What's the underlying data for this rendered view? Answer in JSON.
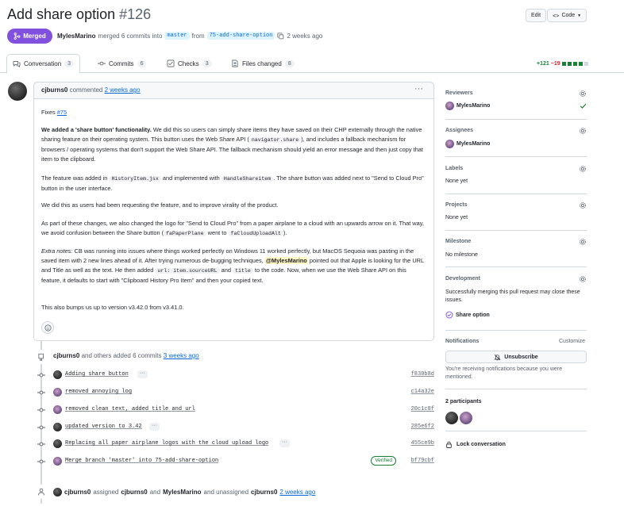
{
  "header": {
    "title": "Add share option",
    "number": "#126",
    "edit_label": "Edit",
    "code_label": "Code",
    "status_label": "Merged",
    "author": "MylesMarino",
    "merge_text": "merged 6 commits into",
    "base_branch": "master",
    "from_text": "from",
    "head_branch": "75-add-share-option",
    "time": "2 weeks ago"
  },
  "tabs": [
    {
      "label": "Conversation",
      "count": "3"
    },
    {
      "label": "Commits",
      "count": "6"
    },
    {
      "label": "Checks",
      "count": "3"
    },
    {
      "label": "Files changed",
      "count": "8"
    }
  ],
  "diffstat": {
    "additions": "+121",
    "deletions": "−19"
  },
  "comment": {
    "author": "cjburns0",
    "action": "commented",
    "time": "2 weeks ago",
    "fixes_label": "Fixes",
    "fixes_link": "#75",
    "p1_bold": "We added a 'share button' functionality.",
    "p1_a": "We did this so users can simply share items they have saved on their CHP externally through the native sharing feature on their operating system. This button uses the Web Share API (",
    "p1_code": "navigator.share",
    "p1_b": "), and includes a fallback mechanism for browsers / operating systems that don't support the Web Share API. The fallback mechanism should yield an error message and then just copy that item to the clipboard.",
    "p2_a": "The feature was added in",
    "p2_code1": "HistoryItem.jsx",
    "p2_b": "and implemented with",
    "p2_code2": "HandleShareitem",
    "p2_c": ". The share button was added next to \"Send to Cloud Pro\" button in the user interface.",
    "p3": "We did this as users had been requesting the feature, and to improve virality of the product.",
    "p4_a": "As part of these changes, we also changed the logo for \"Send to Cloud Pro\" from a paper airplane to a cloud with an upwards arrow on it. That way, we avoid confusion between the Share button (",
    "p4_code1": "faPaperPlane",
    "p4_b": "went to",
    "p4_code2": "faCloudUploadAlt",
    "p4_c": ").",
    "p5_em": "Extra notes:",
    "p5_a": "CB was running into issues where things worked perfectly on Windows 11 worked perfectly, but MacOS Sequoia was pasting in the saved item with 2 new lines ahead of it. After trying numerous de-bugging techniques,",
    "p5_mention": "@MylesMarino",
    "p5_b": "pointed out that Apple is looking for the URL and Title as well as the text. He then added",
    "p5_code1": "url: item.sourceURL",
    "p5_c": "and",
    "p5_code2": "title",
    "p5_d": "to the code. Now, when we use the Web Share API on this feature, it defaults to start with \"Clipboard History Pro Item\" and then your copied text.",
    "p6": "This also bumps us up to version v3.42.0 from v3.41.0."
  },
  "timeline": {
    "summary_author": "cjburns0",
    "summary_text": "and others added 6 commits",
    "summary_time": "3 weeks ago",
    "commits": [
      {
        "message": "Adding share button",
        "sha": "f830b8d",
        "ellipsis": "···",
        "verified": ""
      },
      {
        "message": "removed annoying log",
        "sha": "c14a32e",
        "ellipsis": "",
        "verified": ""
      },
      {
        "message": "removed clean text, added title and url",
        "sha": "20c1c8f",
        "ellipsis": "",
        "verified": ""
      },
      {
        "message": "updated version to 3.42",
        "sha": "285e6f2",
        "ellipsis": "···",
        "verified": ""
      },
      {
        "message": "Replacing all paper airplane logos with the cloud upload logo",
        "sha": "455ce9b",
        "ellipsis": "···",
        "verified": ""
      },
      {
        "message": "Merge branch 'master' into 75-add-share-option",
        "sha": "bf79cbf",
        "ellipsis": "",
        "verified": "Verified"
      }
    ],
    "assign_actor": "cjburns0",
    "assign_text1": "assigned",
    "assign_user1": "cjburns0",
    "assign_and": "and",
    "assign_user2": "MylesMarino",
    "assign_text2": "and unassigned",
    "assign_user3": "cjburns0",
    "assign_time": "2 weeks ago"
  },
  "sidebar": {
    "reviewers_label": "Reviewers",
    "reviewer": "MylesMarino",
    "assignees_label": "Assignees",
    "assignee": "MylesMarino",
    "labels_label": "Labels",
    "labels_value": "None yet",
    "projects_label": "Projects",
    "projects_value": "None yet",
    "milestone_label": "Milestone",
    "milestone_value": "No milestone",
    "development_label": "Development",
    "development_text": "Successfully merging this pull request may close these issues.",
    "development_issue": "Share option",
    "notifications_label": "Notifications",
    "customize_label": "Customize",
    "unsubscribe_label": "Unsubscribe",
    "notify_text": "You're receiving notifications because you were mentioned.",
    "participants_label": "2 participants",
    "lock_label": "Lock conversation"
  },
  "colors": {
    "merged": "#8250df",
    "link": "#0969da",
    "green": "#1a7f37",
    "red": "#d1242f"
  }
}
